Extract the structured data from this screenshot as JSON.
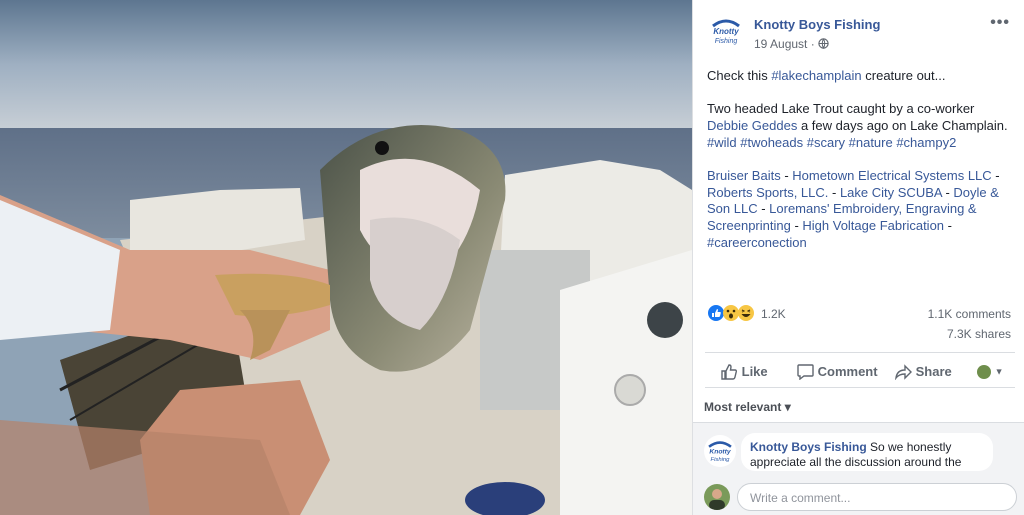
{
  "post": {
    "page_name": "Knotty Boys Fishing",
    "date": "19 August",
    "separator": "·",
    "logo_text": "Knotty Boys Fishing",
    "line1_prefix": "Check this ",
    "line1_tag": "#lakechamplain",
    "line1_suffix": " creature out...",
    "para2": {
      "a": "Two headed Lake Trout caught by a co-worker ",
      "mention": "Debbie Geddes",
      "b": " a few days ago on Lake Champlain. ",
      "tags": "#wild #twoheads #scary #nature #champy2"
    },
    "para3": {
      "t1": "Bruiser Baits",
      "s1": " - ",
      "t2": "Hometown Electrical Systems LLC",
      "s2": " - ",
      "t3": "Roberts Sports, LLC.",
      "s3": " - ",
      "t4": "Lake City SCUBA",
      "s4": " - ",
      "t5": "Doyle & Son LLC",
      "s5": " - ",
      "t6": "Loremans' Embroidery, Engraving & Screenprinting",
      "s6": " - ",
      "t7": "High Voltage Fabrication",
      "s7": " - ",
      "t8": "#careerconection"
    }
  },
  "stats": {
    "reactions": "1.2K",
    "comments": "1.1K comments",
    "shares": "7.3K shares"
  },
  "actions": {
    "like": "Like",
    "comment": "Comment",
    "share": "Share"
  },
  "sort": {
    "label": "Most relevant ▾"
  },
  "top_comment": {
    "author": "Knotty Boys Fishing",
    "text": " So we honestly appreciate all the discussion around the"
  },
  "composer": {
    "placeholder": "Write a comment..."
  },
  "colors": {
    "link": "#385898",
    "sky": "#8fa3b6",
    "water": "#6f8299"
  }
}
